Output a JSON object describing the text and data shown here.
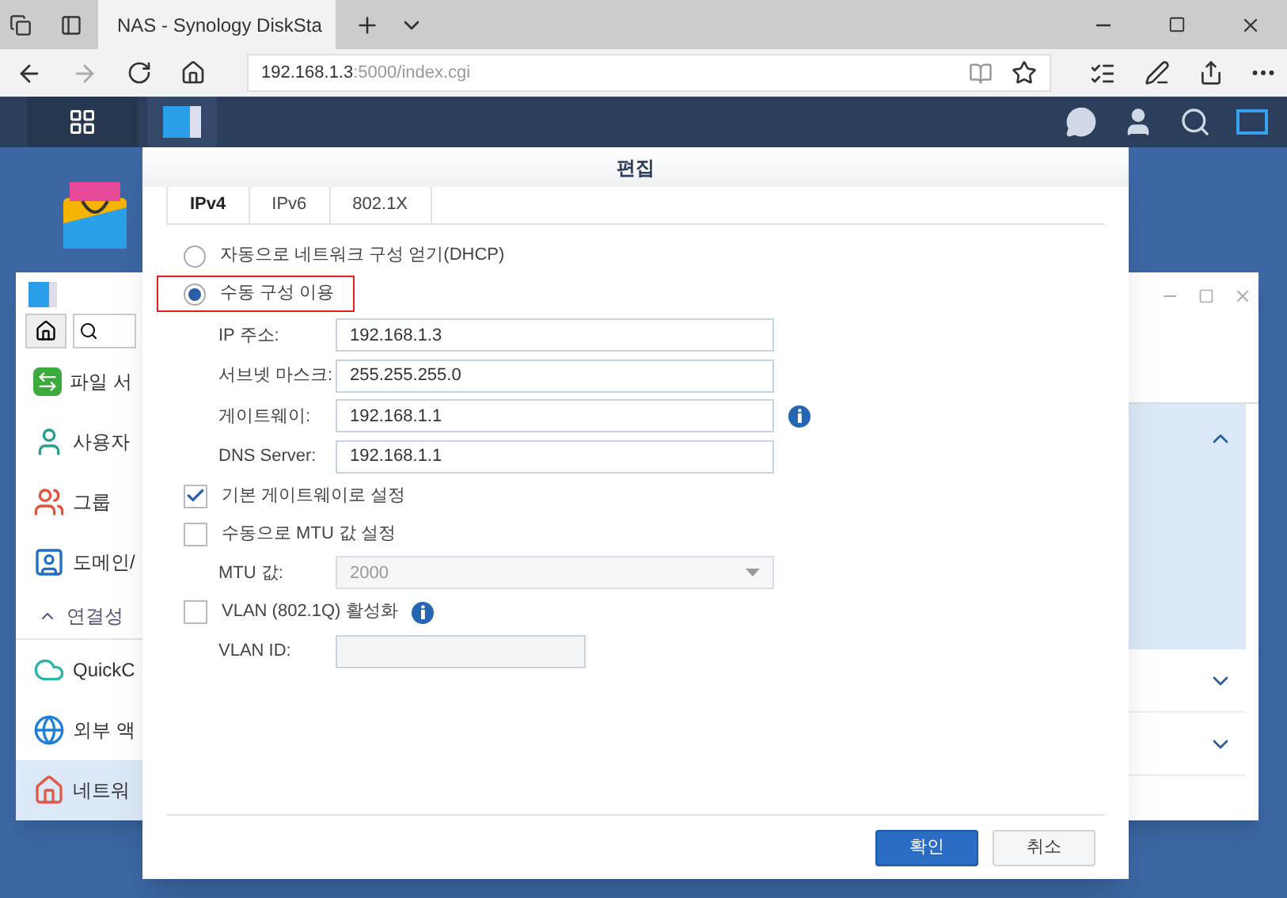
{
  "browser": {
    "tab_title": "NAS - Synology DiskSta",
    "url_host": "192.168.1.3",
    "url_path": ":5000/index.cgi"
  },
  "background_window": {
    "sidebar_items": [
      {
        "kind": "item",
        "label": "파일 서",
        "selected": false
      },
      {
        "kind": "item",
        "label": "사용자",
        "selected": false
      },
      {
        "kind": "item",
        "label": "그룹",
        "selected": false
      },
      {
        "kind": "item",
        "label": "도메인/",
        "selected": false
      },
      {
        "kind": "section",
        "label": "연결성",
        "expanded": true
      },
      {
        "kind": "item",
        "label": "QuickC",
        "selected": false
      },
      {
        "kind": "item",
        "label": "외부 액",
        "selected": false
      },
      {
        "kind": "item",
        "label": "네트워",
        "selected": true
      }
    ]
  },
  "dialog": {
    "title": "편집",
    "tabs": [
      {
        "label": "IPv4",
        "selected": true
      },
      {
        "label": "IPv6",
        "selected": false
      },
      {
        "label": "802.1X",
        "selected": false
      }
    ],
    "network_modes": [
      {
        "label": "자동으로 네트워크 구성 얻기(DHCP)",
        "selected": false,
        "highlighted": false
      },
      {
        "label": "수동 구성 이용",
        "selected": true,
        "highlighted": true
      }
    ],
    "rows": [
      {
        "kind": "field",
        "label": "IP 주소:",
        "value": "192.168.1.3",
        "disabled": false,
        "info": false
      },
      {
        "kind": "field",
        "label": "서브넷 마스크:",
        "value": "255.255.255.0",
        "disabled": false,
        "info": false
      },
      {
        "kind": "field",
        "label": "게이트웨이:",
        "value": "192.168.1.1",
        "disabled": false,
        "info": true
      },
      {
        "kind": "field",
        "label": "DNS Server:",
        "value": "192.168.1.1",
        "disabled": false,
        "info": false
      },
      {
        "kind": "checkbox",
        "label": "기본 게이트웨이로 설정",
        "checked": true,
        "info": false
      },
      {
        "kind": "checkbox",
        "label": "수동으로 MTU 값 설정",
        "checked": false,
        "info": false
      },
      {
        "kind": "select",
        "label": "MTU 값:",
        "value": "2000",
        "disabled": true,
        "info": false
      },
      {
        "kind": "checkbox",
        "label": "VLAN (802.1Q) 활성화",
        "checked": false,
        "info": true
      },
      {
        "kind": "field",
        "label": "VLAN ID:",
        "disabled": true,
        "info": false
      }
    ],
    "buttons": [
      {
        "label": "확인",
        "kind": "primary"
      },
      {
        "label": "취소",
        "kind": "secondary"
      }
    ]
  }
}
